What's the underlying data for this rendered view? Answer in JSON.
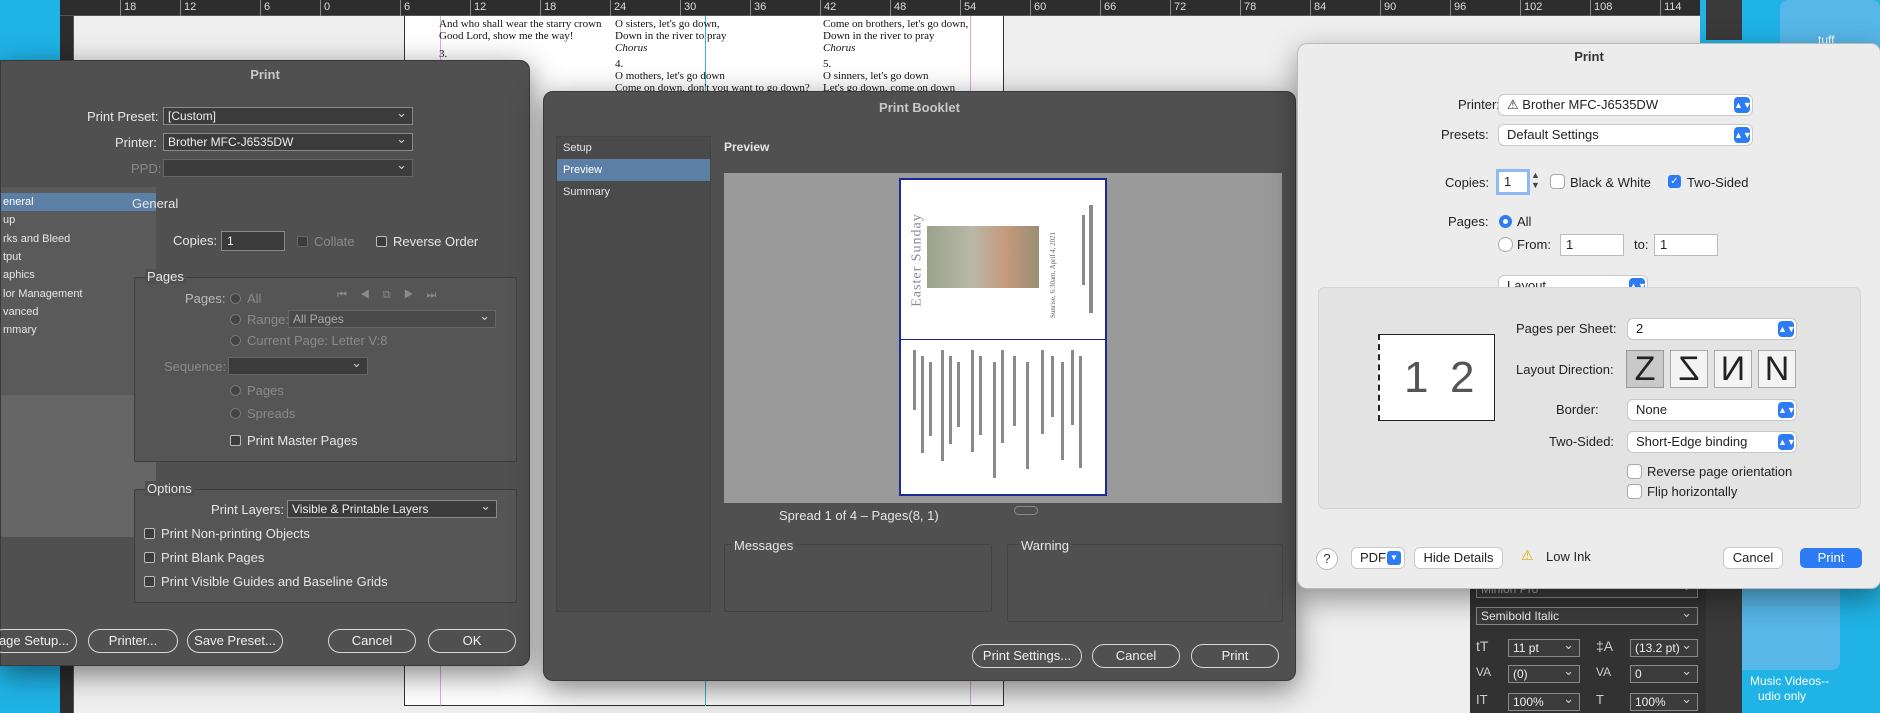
{
  "ruler": {
    "ticks": [
      "18",
      "12",
      "6",
      "0",
      "6",
      "12",
      "18",
      "24",
      "30",
      "36",
      "42",
      "48",
      "54",
      "60",
      "66",
      "72",
      "78",
      "84",
      "90",
      "96",
      "102",
      "108",
      "114"
    ]
  },
  "document": {
    "col1": [
      "And who shall wear the starry crown",
      "Good Lord, show me the way!",
      "3."
    ],
    "col2": [
      "O sisters, let's go down,",
      "Down in the river to pray",
      "Chorus",
      "4.",
      "O mothers, let's go down",
      "Come on down, don't you want to go down?"
    ],
    "col3": [
      "Come on brothers, let's go down,",
      "Down in the river to pray",
      "Chorus",
      "5.",
      "O sinners, let's go down",
      "Let's go down, come on down"
    ]
  },
  "print_dialog": {
    "title": "Print",
    "preset_label": "Print Preset:",
    "preset_value": "[Custom]",
    "printer_label": "Printer:",
    "printer_value": "Brother MFC-J6535DW",
    "ppd_label": "PPD:",
    "sidebar": [
      "eneral",
      "up",
      "rks and Bleed",
      "tput",
      "aphics",
      "lor Management",
      "vanced",
      "mmary"
    ],
    "section_title": "General",
    "copies_label": "Copies:",
    "copies_value": "1",
    "collate_label": "Collate",
    "reverse_label": "Reverse Order",
    "pages_title": "Pages",
    "pages_label": "Pages:",
    "all_label": "All",
    "range_label": "Range:",
    "range_value": "All Pages",
    "current_label": "Current Page: Letter V:8",
    "sequence_label": "Sequence:",
    "pages_opt": "Pages",
    "spreads_opt": "Spreads",
    "master_label": "Print Master Pages",
    "options_title": "Options",
    "layers_label": "Print Layers:",
    "layers_value": "Visible & Printable Layers",
    "nonprint_label": "Print Non-printing Objects",
    "blank_label": "Print Blank Pages",
    "guides_label": "Print Visible Guides and Baseline Grids",
    "btn_page_setup": "age Setup...",
    "btn_printer": "Printer...",
    "btn_save_preset": "Save Preset...",
    "btn_cancel": "Cancel",
    "btn_ok": "OK"
  },
  "booklet_dialog": {
    "title": "Print Booklet",
    "nav": [
      "Setup",
      "Preview",
      "Summary"
    ],
    "preview_heading": "Preview",
    "spread_text": "Spread 1 of 4 – Pages(8, 1)",
    "thumb_title": "Easter Sunday",
    "thumb_subtitle": "Sunrise, 6:30am, April 4, 2021",
    "messages_label": "Messages",
    "warning_label": "Warning",
    "btn_settings": "Print Settings...",
    "btn_cancel": "Cancel",
    "btn_print": "Print"
  },
  "mac_print": {
    "title": "Print",
    "printer_label": "Printer:",
    "printer_value": "Brother MFC-J6535DW",
    "presets_label": "Presets:",
    "presets_value": "Default Settings",
    "copies_label": "Copies:",
    "copies_value": "1",
    "bw_label": "Black & White",
    "twosided_label": "Two-Sided",
    "pages_label": "Pages:",
    "all_label": "All",
    "from_label": "From:",
    "from_value": "1",
    "to_label": "to:",
    "to_value": "1",
    "section_value": "Layout",
    "pps_label": "Pages per Sheet:",
    "pps_value": "2",
    "preview_1": "1",
    "preview_2": "2",
    "direction_label": "Layout Direction:",
    "border_label": "Border:",
    "border_value": "None",
    "two_sided_label": "Two-Sided:",
    "two_sided_value": "Short-Edge binding",
    "reverse_label": "Reverse page orientation",
    "flip_label": "Flip horizontally",
    "help": "?",
    "pdf_label": "PDF",
    "hide_details": "Hide Details",
    "low_ink": "Low Ink",
    "btn_cancel": "Cancel",
    "btn_print": "Print"
  },
  "right_panel": {
    "font_family": "Minion Pro",
    "font_style": "Semibold Italic",
    "size": "11 pt",
    "leading": "(13.2 pt)",
    "kerning": "(0)",
    "tracking": "0",
    "vscale": "100%",
    "hscale": "100%",
    "desktop_tag1": "tuff",
    "desktop_tag2": "Music Videos--",
    "desktop_tag3": "udio only"
  },
  "colors": {
    "accent": "#2d7cf6",
    "dialog_bg": "#505050",
    "desktop": "#1fb3e6"
  }
}
